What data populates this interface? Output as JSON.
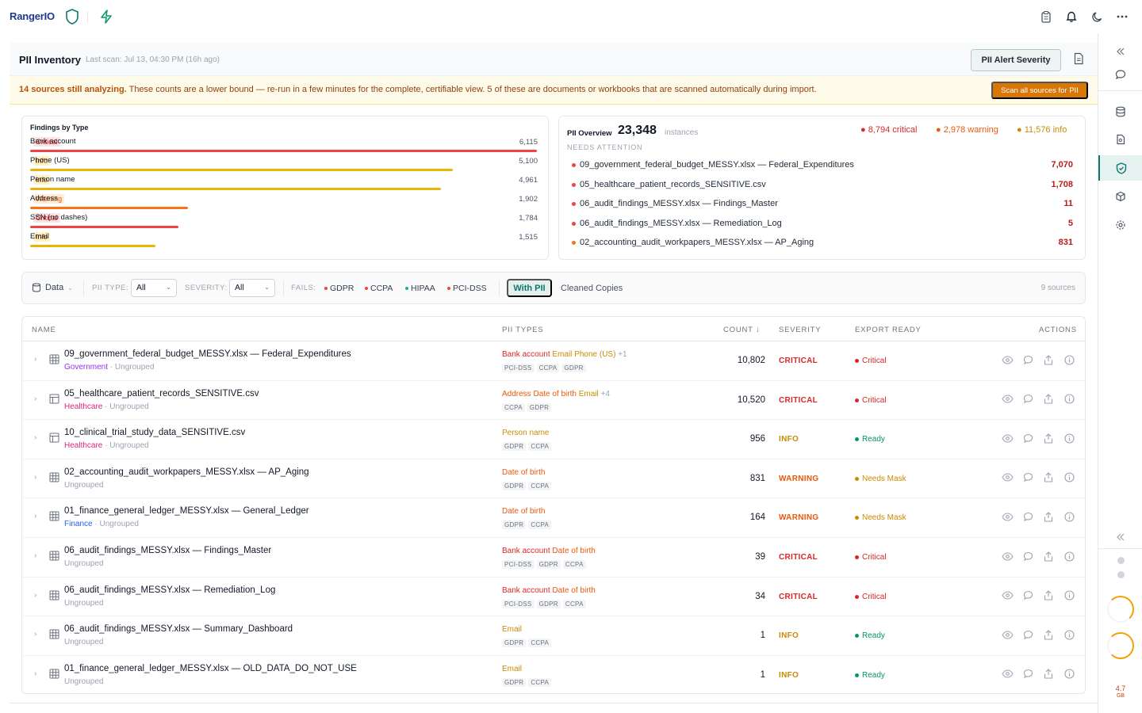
{
  "app": {
    "name": "RangerIO"
  },
  "header": {
    "title": "PII Inventory",
    "last_scan": "Last scan: Jul 13, 04:30 PM (16h ago)",
    "alert_button": "PII Alert Severity"
  },
  "banner": {
    "lead": "14 sources still analyzing.",
    "text": "These counts are a lower bound — re-run in a few minutes for the complete, certifiable view. 5 of these are documents or workbooks that are scanned automatically during import.",
    "button": "Scan all sources for PII"
  },
  "findings": {
    "title": "Findings by Type",
    "rows": [
      {
        "label": "Bank account",
        "severity": "Critical",
        "count": "6,115",
        "fraction": 1.0,
        "color": "#ef4444"
      },
      {
        "label": "Phone (US)",
        "severity": "Info",
        "count": "5,100",
        "fraction": 0.834,
        "color": "#eab308"
      },
      {
        "label": "Person name",
        "severity": "Info",
        "count": "4,961",
        "fraction": 0.811,
        "color": "#eab308"
      },
      {
        "label": "Address",
        "severity": "Warning",
        "count": "1,902",
        "fraction": 0.311,
        "color": "#f97316"
      },
      {
        "label": "SSN (no dashes)",
        "severity": "Critical",
        "count": "1,784",
        "fraction": 0.292,
        "color": "#ef4444"
      },
      {
        "label": "Email",
        "severity": "Info",
        "count": "1,515",
        "fraction": 0.248,
        "color": "#eab308"
      }
    ]
  },
  "overview": {
    "label": "PII Overview",
    "total": "23,348",
    "total_unit": "instances",
    "critical": "8,794 critical",
    "warning": "2,978 warning",
    "info": "11,576 info",
    "needs_attention": "NEEDS ATTENTION",
    "items": [
      {
        "name": "09_government_federal_budget_MESSY.xlsx — Federal_Expenditures",
        "count": "7,070",
        "dot": "#ef4444"
      },
      {
        "name": "05_healthcare_patient_records_SENSITIVE.csv",
        "count": "1,708",
        "dot": "#ef4444"
      },
      {
        "name": "06_audit_findings_MESSY.xlsx — Findings_Master",
        "count": "11",
        "dot": "#ef4444"
      },
      {
        "name": "06_audit_findings_MESSY.xlsx — Remediation_Log",
        "count": "5",
        "dot": "#ef4444"
      },
      {
        "name": "02_accounting_audit_workpapers_MESSY.xlsx — AP_Aging",
        "count": "831",
        "dot": "#f97316"
      }
    ]
  },
  "filters": {
    "data_label": "Data",
    "pii_type_label": "PII TYPE:",
    "pii_type_value": "All",
    "severity_label": "SEVERITY:",
    "severity_value": "All",
    "fails_label": "FAILS:",
    "fails": [
      {
        "name": "GDPR",
        "color": "#ef4444"
      },
      {
        "name": "CCPA",
        "color": "#ef4444"
      },
      {
        "name": "HIPAA",
        "color": "#10b981"
      },
      {
        "name": "PCI-DSS",
        "color": "#ef4444"
      }
    ],
    "with_pii": "With PII",
    "cleaned": "Cleaned Copies",
    "sources": "9 sources"
  },
  "table": {
    "headers": {
      "name": "NAME",
      "pii_types": "PII TYPES",
      "count": "COUNT ↓",
      "severity": "SEVERITY",
      "export": "EXPORT READY",
      "actions": "ACTIONS"
    },
    "rows": [
      {
        "name": "09_government_federal_budget_MESSY.xlsx — Federal_Expenditures",
        "tag": "Government",
        "tag_color": "#9333ea",
        "group": "Ungrouped",
        "pii": [
          {
            "t": "Bank account",
            "c": "#dc2626"
          },
          {
            "t": "Email",
            "c": "#ca8a04"
          },
          {
            "t": "Phone (US)",
            "c": "#ca8a04"
          }
        ],
        "more": "+1",
        "chips": [
          "PCI-DSS",
          "CCPA",
          "GDPR"
        ],
        "count": "10,802",
        "severity": "CRITICAL",
        "sev_color": "#dc2626",
        "export": "Critical",
        "exp_color": "#dc2626",
        "icon": "grid"
      },
      {
        "name": "05_healthcare_patient_records_SENSITIVE.csv",
        "tag": "Healthcare",
        "tag_color": "#db2777",
        "group": "Ungrouped",
        "pii": [
          {
            "t": "Address",
            "c": "#ea580c"
          },
          {
            "t": "Date of birth",
            "c": "#ea580c"
          },
          {
            "t": "Email",
            "c": "#ca8a04"
          }
        ],
        "more": "+4",
        "chips": [
          "CCPA",
          "GDPR"
        ],
        "count": "10,520",
        "severity": "CRITICAL",
        "sev_color": "#dc2626",
        "export": "Critical",
        "exp_color": "#dc2626",
        "icon": "csv"
      },
      {
        "name": "10_clinical_trial_study_data_SENSITIVE.csv",
        "tag": "Healthcare",
        "tag_color": "#db2777",
        "group": "Ungrouped",
        "pii": [
          {
            "t": "Person name",
            "c": "#ca8a04"
          }
        ],
        "more": "",
        "chips": [
          "GDPR",
          "CCPA"
        ],
        "count": "956",
        "severity": "INFO",
        "sev_color": "#ca8a04",
        "export": "Ready",
        "exp_color": "#059669",
        "icon": "csv"
      },
      {
        "name": "02_accounting_audit_workpapers_MESSY.xlsx — AP_Aging",
        "tag": "",
        "tag_color": "",
        "group": "Ungrouped",
        "pii": [
          {
            "t": "Date of birth",
            "c": "#ea580c"
          }
        ],
        "more": "",
        "chips": [
          "GDPR",
          "CCPA"
        ],
        "count": "831",
        "severity": "WARNING",
        "sev_color": "#ea580c",
        "export": "Needs Mask",
        "exp_color": "#ca8a04",
        "icon": "grid"
      },
      {
        "name": "01_finance_general_ledger_MESSY.xlsx — General_Ledger",
        "tag": "Finance",
        "tag_color": "#2563eb",
        "group": "Ungrouped",
        "pii": [
          {
            "t": "Date of birth",
            "c": "#ea580c"
          }
        ],
        "more": "",
        "chips": [
          "GDPR",
          "CCPA"
        ],
        "count": "164",
        "severity": "WARNING",
        "sev_color": "#ea580c",
        "export": "Needs Mask",
        "exp_color": "#ca8a04",
        "icon": "grid"
      },
      {
        "name": "06_audit_findings_MESSY.xlsx — Findings_Master",
        "tag": "",
        "tag_color": "",
        "group": "Ungrouped",
        "pii": [
          {
            "t": "Bank account",
            "c": "#dc2626"
          },
          {
            "t": "Date of birth",
            "c": "#ea580c"
          }
        ],
        "more": "",
        "chips": [
          "PCI-DSS",
          "GDPR",
          "CCPA"
        ],
        "count": "39",
        "severity": "CRITICAL",
        "sev_color": "#dc2626",
        "export": "Critical",
        "exp_color": "#dc2626",
        "icon": "grid"
      },
      {
        "name": "06_audit_findings_MESSY.xlsx — Remediation_Log",
        "tag": "",
        "tag_color": "",
        "group": "Ungrouped",
        "pii": [
          {
            "t": "Bank account",
            "c": "#dc2626"
          },
          {
            "t": "Date of birth",
            "c": "#ea580c"
          }
        ],
        "more": "",
        "chips": [
          "PCI-DSS",
          "GDPR",
          "CCPA"
        ],
        "count": "34",
        "severity": "CRITICAL",
        "sev_color": "#dc2626",
        "export": "Critical",
        "exp_color": "#dc2626",
        "icon": "grid"
      },
      {
        "name": "06_audit_findings_MESSY.xlsx — Summary_Dashboard",
        "tag": "",
        "tag_color": "",
        "group": "Ungrouped",
        "pii": [
          {
            "t": "Email",
            "c": "#ca8a04"
          }
        ],
        "more": "",
        "chips": [
          "GDPR",
          "CCPA"
        ],
        "count": "1",
        "severity": "INFO",
        "sev_color": "#ca8a04",
        "export": "Ready",
        "exp_color": "#059669",
        "icon": "grid"
      },
      {
        "name": "01_finance_general_ledger_MESSY.xlsx — OLD_DATA_DO_NOT_USE",
        "tag": "",
        "tag_color": "",
        "group": "Ungrouped",
        "pii": [
          {
            "t": "Email",
            "c": "#ca8a04"
          }
        ],
        "more": "",
        "chips": [
          "GDPR",
          "CCPA"
        ],
        "count": "1",
        "severity": "INFO",
        "sev_color": "#ca8a04",
        "export": "Ready",
        "exp_color": "#059669",
        "icon": "grid"
      }
    ]
  },
  "rail": {
    "memory": "4.7",
    "memory_unit": "GB"
  },
  "colors": {
    "critical": "#dc2626",
    "warning": "#ea580c",
    "info": "#ca8a04",
    "accent": "#0f766e"
  }
}
